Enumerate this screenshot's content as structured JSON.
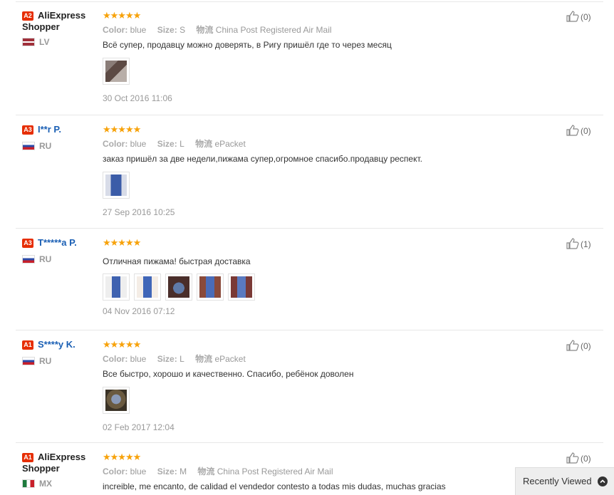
{
  "colors": {
    "level_badge": "#e62e04",
    "stars": "#f7a20a",
    "username": "#1a5fb4"
  },
  "reviews": [
    {
      "level": "A2",
      "name_part1": "AliExpress",
      "name_part2": "Shopper",
      "country": "LV",
      "stars": "★★★★★",
      "color_label": "Color:",
      "color": "blue",
      "size_label": "Size:",
      "size": "S",
      "logistics_label": "物流",
      "logistics": "China Post Registered Air Mail",
      "text": "Всё супер, продавцу можно доверять, в Ригу пришёл где то через месяц",
      "date": "30 Oct 2016 11:06",
      "helpful": "(0)",
      "photo_count": 1
    },
    {
      "level": "A3",
      "name": "I**r P.",
      "country": "RU",
      "stars": "★★★★★",
      "color_label": "Color:",
      "color": "blue",
      "size_label": "Size:",
      "size": "L",
      "logistics_label": "物流",
      "logistics": "ePacket",
      "text": "заказ пришёл за две недели,пижама супер,огромное спасибо.продавцу респект.",
      "date": "27 Sep 2016 10:25",
      "helpful": "(0)",
      "photo_count": 1
    },
    {
      "level": "A3",
      "name": "T*****a P.",
      "country": "RU",
      "stars": "★★★★★",
      "text": "Отличная пижама!   быстрая доставка",
      "date": "04 Nov 2016 07:12",
      "helpful": "(1)",
      "photo_count": 5
    },
    {
      "level": "A1",
      "name": "S****y K.",
      "country": "RU",
      "stars": "★★★★★",
      "color_label": "Color:",
      "color": "blue",
      "size_label": "Size:",
      "size": "L",
      "logistics_label": "物流",
      "logistics": "ePacket",
      "text": "Все быстро, хорошо и качественно. Спасибо, ребёнок доволен",
      "date": "02 Feb 2017 12:04",
      "helpful": "(0)",
      "photo_count": 1
    },
    {
      "level": "A1",
      "name_part1": "AliExpress",
      "name_part2": "Shopper",
      "country": "MX",
      "stars": "★★★★★",
      "color_label": "Color:",
      "color": "blue",
      "size_label": "Size:",
      "size": "M",
      "logistics_label": "物流",
      "logistics": "China Post Registered Air Mail",
      "text": "increible, me encanto, de calidad el vendedor contesto a todas mis dudas, muchas gracias",
      "helpful": "(0)"
    }
  ],
  "recently_viewed": {
    "label": "Recently Viewed",
    "icon": "chevron-up-icon"
  }
}
